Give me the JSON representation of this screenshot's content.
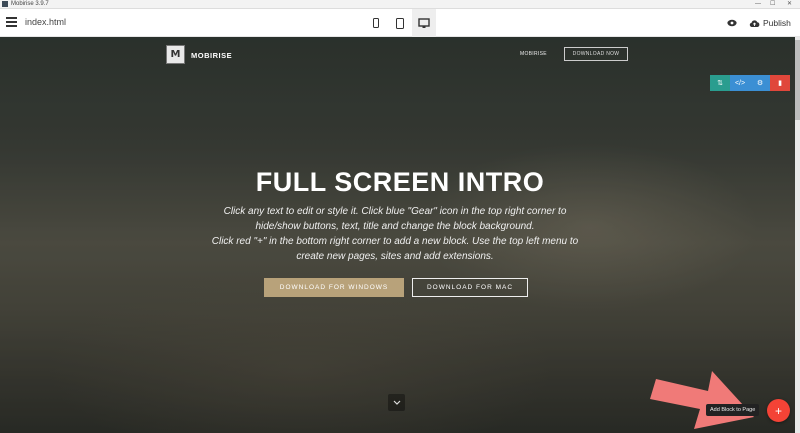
{
  "window": {
    "title": "Mobirise 3.9.7",
    "minimize": "—",
    "maximize": "☐",
    "close": "✕"
  },
  "toolbar": {
    "page_name": "index.html",
    "devices": [
      "mobile",
      "tablet",
      "desktop"
    ],
    "active_device": "desktop",
    "publish_label": "Publish"
  },
  "site": {
    "logo_letter": "M",
    "brand": "MOBIRISE",
    "nav_link": "MOBIRISE",
    "nav_button": "DOWNLOAD NOW"
  },
  "block_tools": [
    {
      "icon": "arrows-vertical-icon",
      "glyph": "⇅",
      "color": "#2a9d8f"
    },
    {
      "icon": "code-icon",
      "glyph": "</>",
      "color": "#3b8fd4"
    },
    {
      "icon": "gear-icon",
      "glyph": "⚙",
      "color": "#3b8fd4"
    },
    {
      "icon": "trash-icon",
      "glyph": "▮",
      "color": "#e0473b"
    }
  ],
  "hero": {
    "title": "FULL SCREEN INTRO",
    "text_line1": "Click any text to edit or style it. Click blue \"Gear\" icon in the top right corner to",
    "text_line2": "hide/show buttons, text, title and change the block background.",
    "text_line3": "Click red \"+\" in the bottom right corner to add a new block. Use the top left menu to",
    "text_line4": "create new pages, sites and add extensions.",
    "button_primary": "DOWNLOAD FOR WINDOWS",
    "button_secondary": "DOWNLOAD FOR MAC"
  },
  "add_block": {
    "tooltip": "Add Block to Page",
    "glyph": "+"
  },
  "colors": {
    "accent": "#f44336",
    "annotation_arrow": "#f07a78",
    "button_gold": "#b8a27a"
  }
}
